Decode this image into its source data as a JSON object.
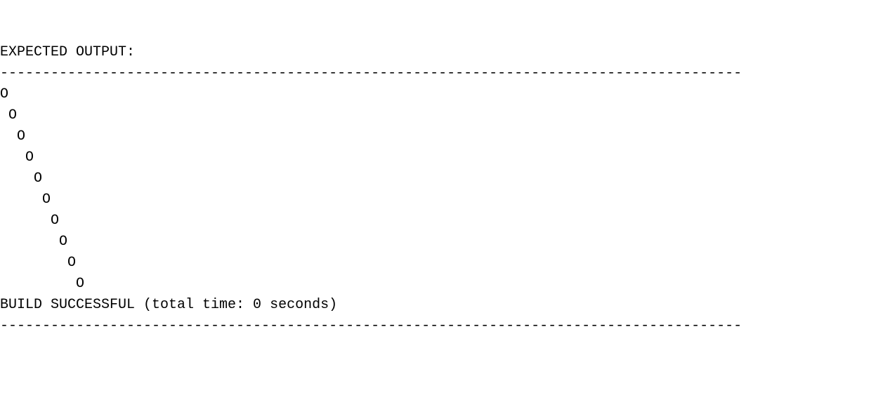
{
  "header": {
    "title": "EXPECTED OUTPUT:"
  },
  "divider": {
    "line": "----------------------------------------------------------------------------------------"
  },
  "output": {
    "lines": [
      "O",
      " O",
      "  O",
      "   O",
      "    O",
      "     O",
      "      O",
      "       O",
      "        O",
      "         O"
    ]
  },
  "footer": {
    "status": "BUILD SUCCESSFUL (total time: 0 seconds)"
  }
}
